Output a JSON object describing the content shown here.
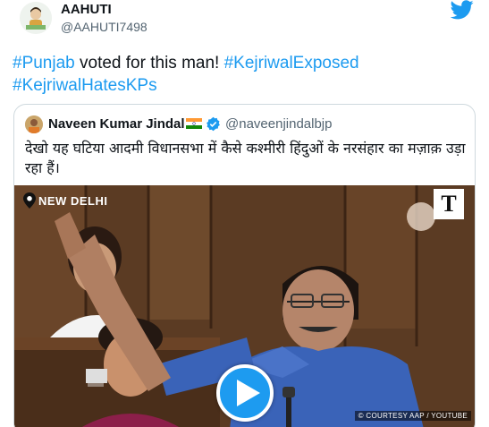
{
  "author": {
    "display_name": "AAHUTI",
    "handle": "@AAHUTI7498"
  },
  "tweet": {
    "parts": [
      {
        "text": "#Punjab",
        "hashtag": true
      },
      {
        "text": " voted for this man! ",
        "hashtag": false
      },
      {
        "text": "#KejriwalExposed",
        "hashtag": true
      },
      {
        "text": " ",
        "hashtag": false
      },
      {
        "text": "#KejriwalHatesKPs",
        "hashtag": true
      }
    ]
  },
  "quoted_tweet": {
    "display_name": "Naveen Kumar Jindal",
    "handle": "@naveenjindalbjp",
    "text": "देखो यह घटिया आदमी विधानसभा में कैसे कश्मीरी हिंदुओं के नरसंहार का मज़ाक़ उड़ा रहा हैं।",
    "video": {
      "location_label": "NEW DELHI",
      "channel_logo": "T",
      "courtesy": "© COURTESY AAP / YOUTUBE"
    }
  },
  "icons": {
    "brand": "twitter-bird-icon",
    "verified": "verified-badge-icon",
    "flag": "india-flag-icon",
    "play": "play-icon",
    "location": "location-pin-icon"
  },
  "colors": {
    "link": "#1d9bf0",
    "text": "#0f1419",
    "secondary": "#536471",
    "border": "#cfd9de"
  }
}
